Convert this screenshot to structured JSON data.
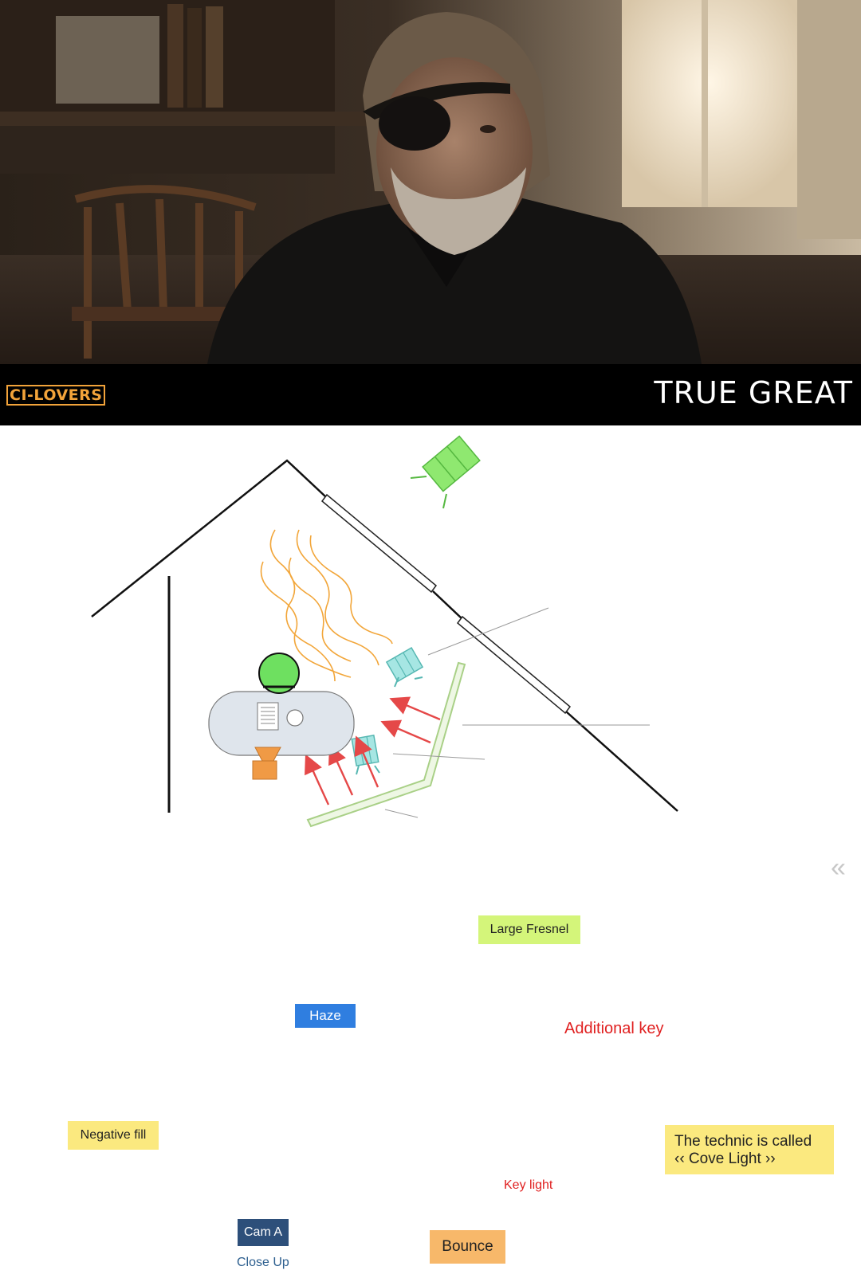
{
  "banner": {
    "logo_text": "CI-LOVERS",
    "title": "TRUE GREAT"
  },
  "photo": {
    "subject": "film-still-man-with-eyepatch"
  },
  "diagram": {
    "collapse_icon": "double-chevron-left-icon",
    "labels": {
      "large_fresnel": "Large Fresnel",
      "haze": "Haze",
      "additional_key": "Additional key",
      "negative_fill": "Negative fill",
      "technic_line1": "The technic is called",
      "technic_line2": "‹‹ Cove Light ››",
      "key_light": "Key light",
      "cam_a": "Cam A",
      "close_up": "Close Up",
      "bounce": "Bounce"
    },
    "colors": {
      "fresnel": "#86e86a",
      "fresnel_label_bg": "#d4f57a",
      "haze_line": "#f2a63a",
      "haze_label_bg": "#2f7ee0",
      "additional_key_text": "#e02020",
      "arrow": "#e54848",
      "small_light": "#9fe3e0",
      "negative_fill_bg": "#fbe97f",
      "technic_bg": "#fbe97f",
      "key_light_text": "#e02020",
      "cam_a_bg": "#2d4f7a",
      "close_up_text": "#2d5f8f",
      "bounce_bg": "#f7b86a",
      "bounce_frame": "#b9d89a",
      "subject": "#6ee060",
      "table": "#dde3ea",
      "camera": "#f09a45"
    }
  }
}
